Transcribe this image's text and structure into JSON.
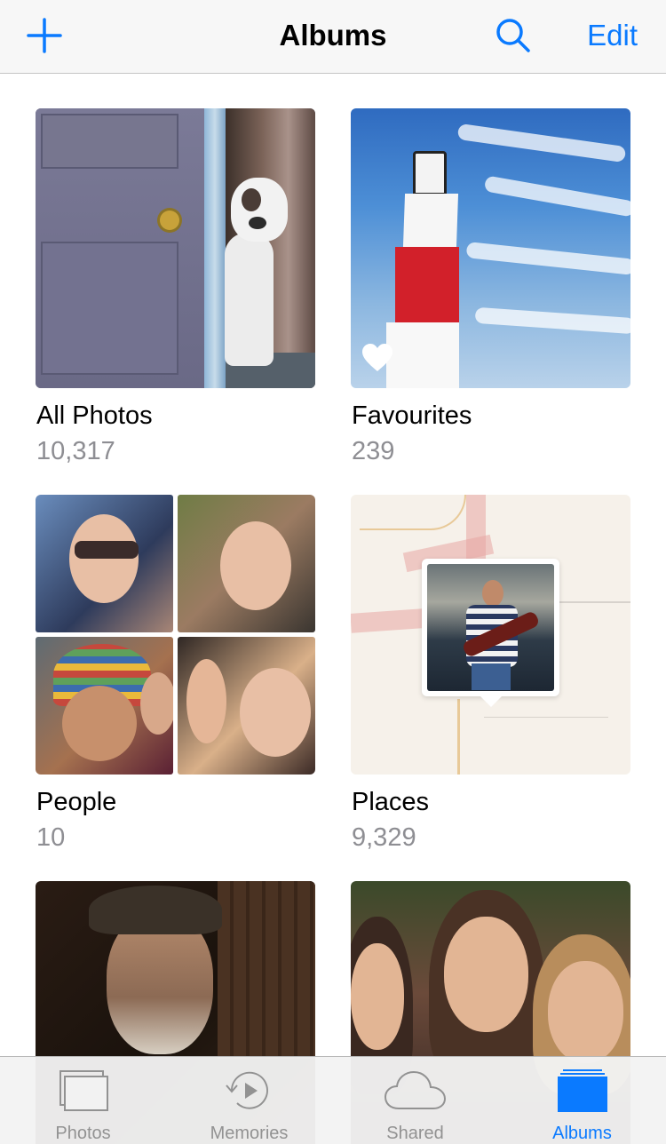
{
  "nav": {
    "title": "Albums",
    "edit_label": "Edit",
    "add_icon": "plus-icon",
    "search_icon": "search-icon",
    "accent_color": "#0a7aff"
  },
  "albums": [
    {
      "name": "All Photos",
      "count": "10,317"
    },
    {
      "name": "Favourites",
      "count": "239"
    },
    {
      "name": "People",
      "count": "10"
    },
    {
      "name": "Places",
      "count": "9,329"
    },
    {
      "name": "",
      "count": ""
    },
    {
      "name": "",
      "count": ""
    }
  ],
  "tabs": [
    {
      "label": "Photos",
      "icon": "photos-stack-icon",
      "active": false
    },
    {
      "label": "Memories",
      "icon": "memories-play-icon",
      "active": false
    },
    {
      "label": "Shared",
      "icon": "cloud-icon",
      "active": false
    },
    {
      "label": "Albums",
      "icon": "albums-stack-icon",
      "active": true
    }
  ]
}
